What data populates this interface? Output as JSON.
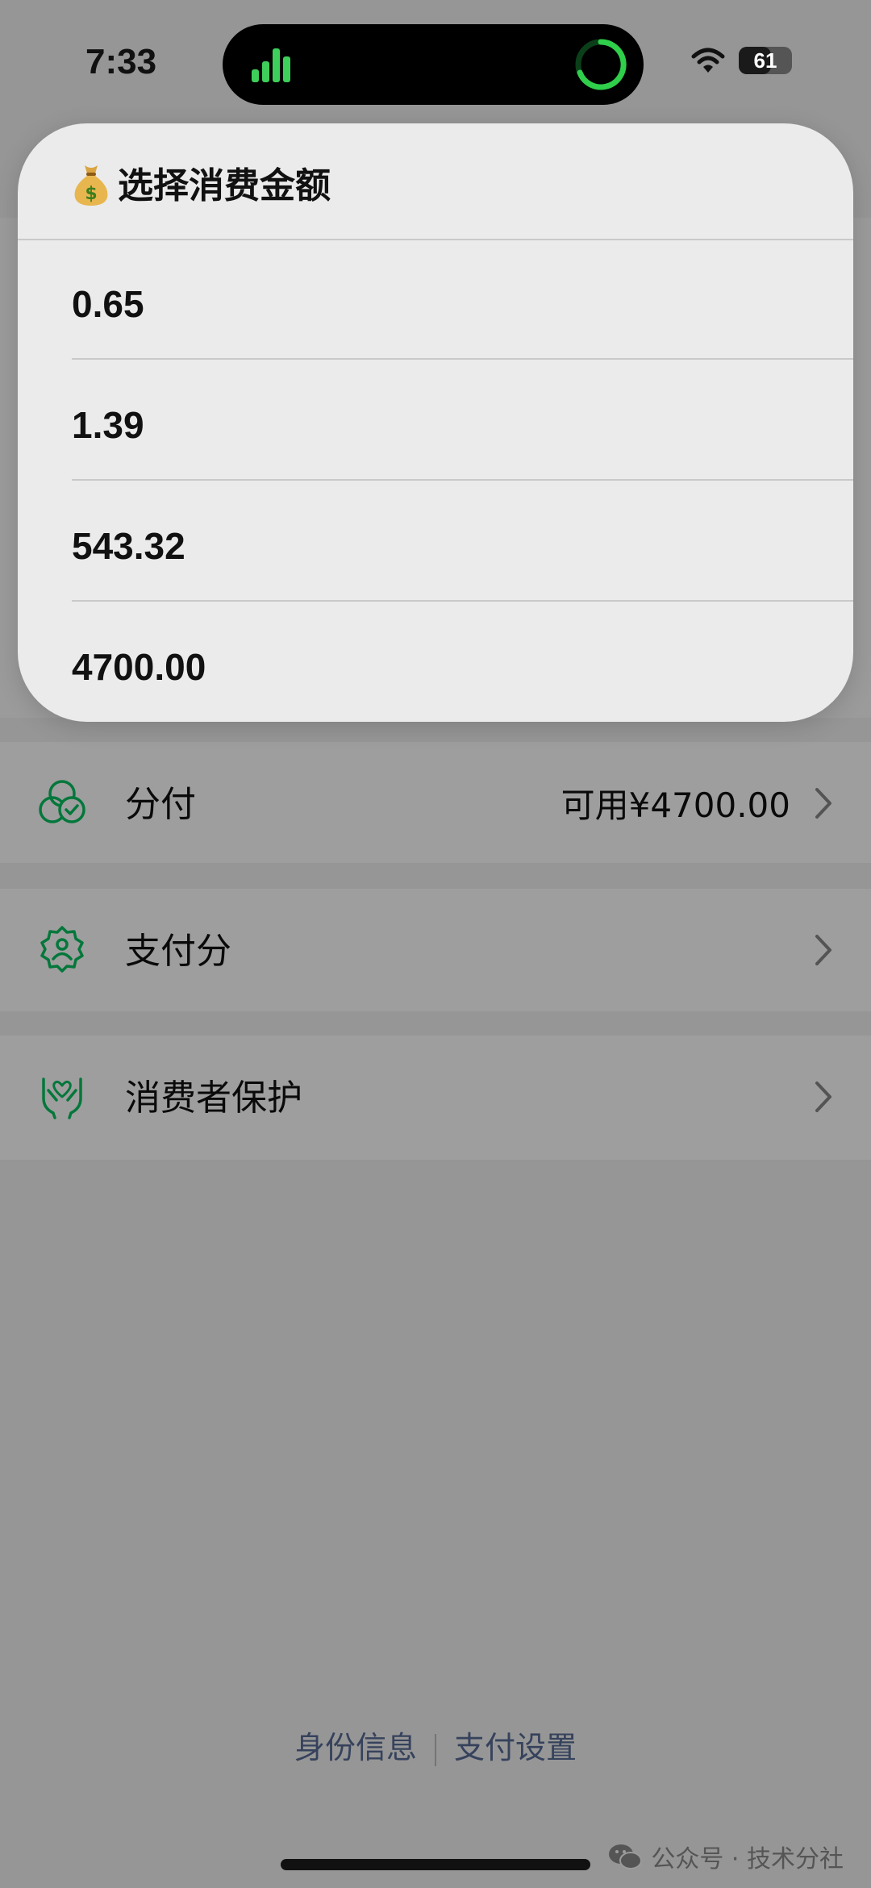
{
  "status_bar": {
    "time": "7:33",
    "battery": "61",
    "battery_level": 0.61
  },
  "popup": {
    "title": "选择消费金额",
    "title_icon": "money-bag-icon",
    "options": [
      "0.65",
      "1.39",
      "543.32",
      "4700.00"
    ]
  },
  "rows": [
    {
      "label": "分付",
      "value": "可用¥4700.00",
      "icon": "fenfu-icon"
    },
    {
      "label": "支付分",
      "value": "",
      "icon": "payscore-icon"
    },
    {
      "label": "消费者保护",
      "value": "",
      "icon": "protect-hands-icon"
    }
  ],
  "footer": {
    "identity": "身份信息",
    "settings": "支付设置"
  },
  "watermark": "公众号 · 技术分社",
  "colors": {
    "accent_green": "#07c160",
    "link_blue": "#576b95"
  }
}
